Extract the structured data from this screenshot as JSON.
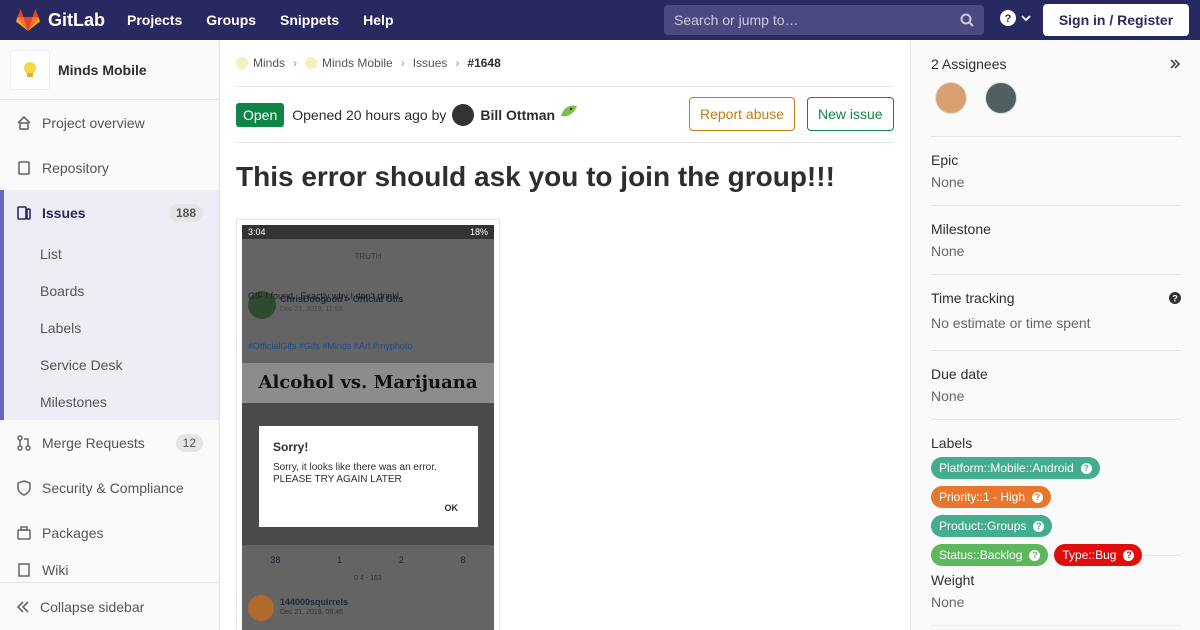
{
  "topbar": {
    "brand": "GitLab",
    "nav": [
      "Projects",
      "Groups",
      "Snippets",
      "Help"
    ],
    "search_placeholder": "Search or jump to…",
    "signin": "Sign in / Register"
  },
  "sidebar": {
    "project_name": "Minds Mobile",
    "items": [
      {
        "label": "Project overview",
        "icon": "home-icon"
      },
      {
        "label": "Repository",
        "icon": "document-icon"
      },
      {
        "label": "Issues",
        "icon": "issues-icon",
        "count": "188"
      },
      {
        "label": "Merge Requests",
        "icon": "merge-request-icon",
        "count": "12"
      },
      {
        "label": "Security & Compliance",
        "icon": "shield-icon"
      },
      {
        "label": "Packages",
        "icon": "package-icon"
      },
      {
        "label": "Wiki",
        "icon": "book-icon"
      }
    ],
    "issue_subitems": [
      "List",
      "Boards",
      "Labels",
      "Service Desk",
      "Milestones"
    ],
    "collapse": "Collapse sidebar"
  },
  "breadcrumb": [
    "Minds",
    "Minds Mobile",
    "Issues",
    "#1648"
  ],
  "issue": {
    "status": "Open",
    "opened_text": "Opened 20 hours ago by",
    "author": "Bill Ottman",
    "report_abuse": "Report abuse",
    "new_issue": "New issue",
    "title": "This error should ask you to join the group!!!"
  },
  "screenshot": {
    "time": "3:04",
    "battery": "18%",
    "header_logo": "TRUTH",
    "post_author": "ChrisDoogood",
    "post_group": "Official Gifs",
    "post_date": "Dec 21, 2019, 11:53",
    "post_text": "GIF I found.. Exactly why I don't drink!",
    "post_tags": "#OfficialGifs #Gifs #Minds #Art #myphoto",
    "meme": "Alcohol vs. Marijuana",
    "dialog_title": "Sorry!",
    "dialog_message": "Sorry, it looks like there was an error. PLEASE TRY AGAIN LATER",
    "dialog_ok": "OK",
    "stats": {
      "up": "38",
      "down": "1",
      "comments": "2",
      "reminds": "8",
      "votes": "0 4 - 163"
    },
    "next_author": "144000squirrels",
    "next_date": "Dec 21, 2019, 08:46"
  },
  "right_sidebar": {
    "assignees": "2 Assignees",
    "epic": {
      "label": "Epic",
      "value": "None"
    },
    "milestone": {
      "label": "Milestone",
      "value": "None"
    },
    "time_tracking": {
      "label": "Time tracking",
      "value": "No estimate or time spent"
    },
    "due_date": {
      "label": "Due date",
      "value": "None"
    },
    "labels_title": "Labels",
    "labels": [
      {
        "text": "Platform::Mobile::Android",
        "color": "#44ad8e"
      },
      {
        "text": "Priority::1 - High",
        "color": "#e8762d"
      },
      {
        "text": "Product::Groups",
        "color": "#44ad8e"
      },
      {
        "text": "Status::Backlog",
        "color": "#5cb85c"
      },
      {
        "text": "Type::Bug",
        "color": "#e10d0d"
      }
    ],
    "weight": {
      "label": "Weight",
      "value": "None"
    }
  }
}
